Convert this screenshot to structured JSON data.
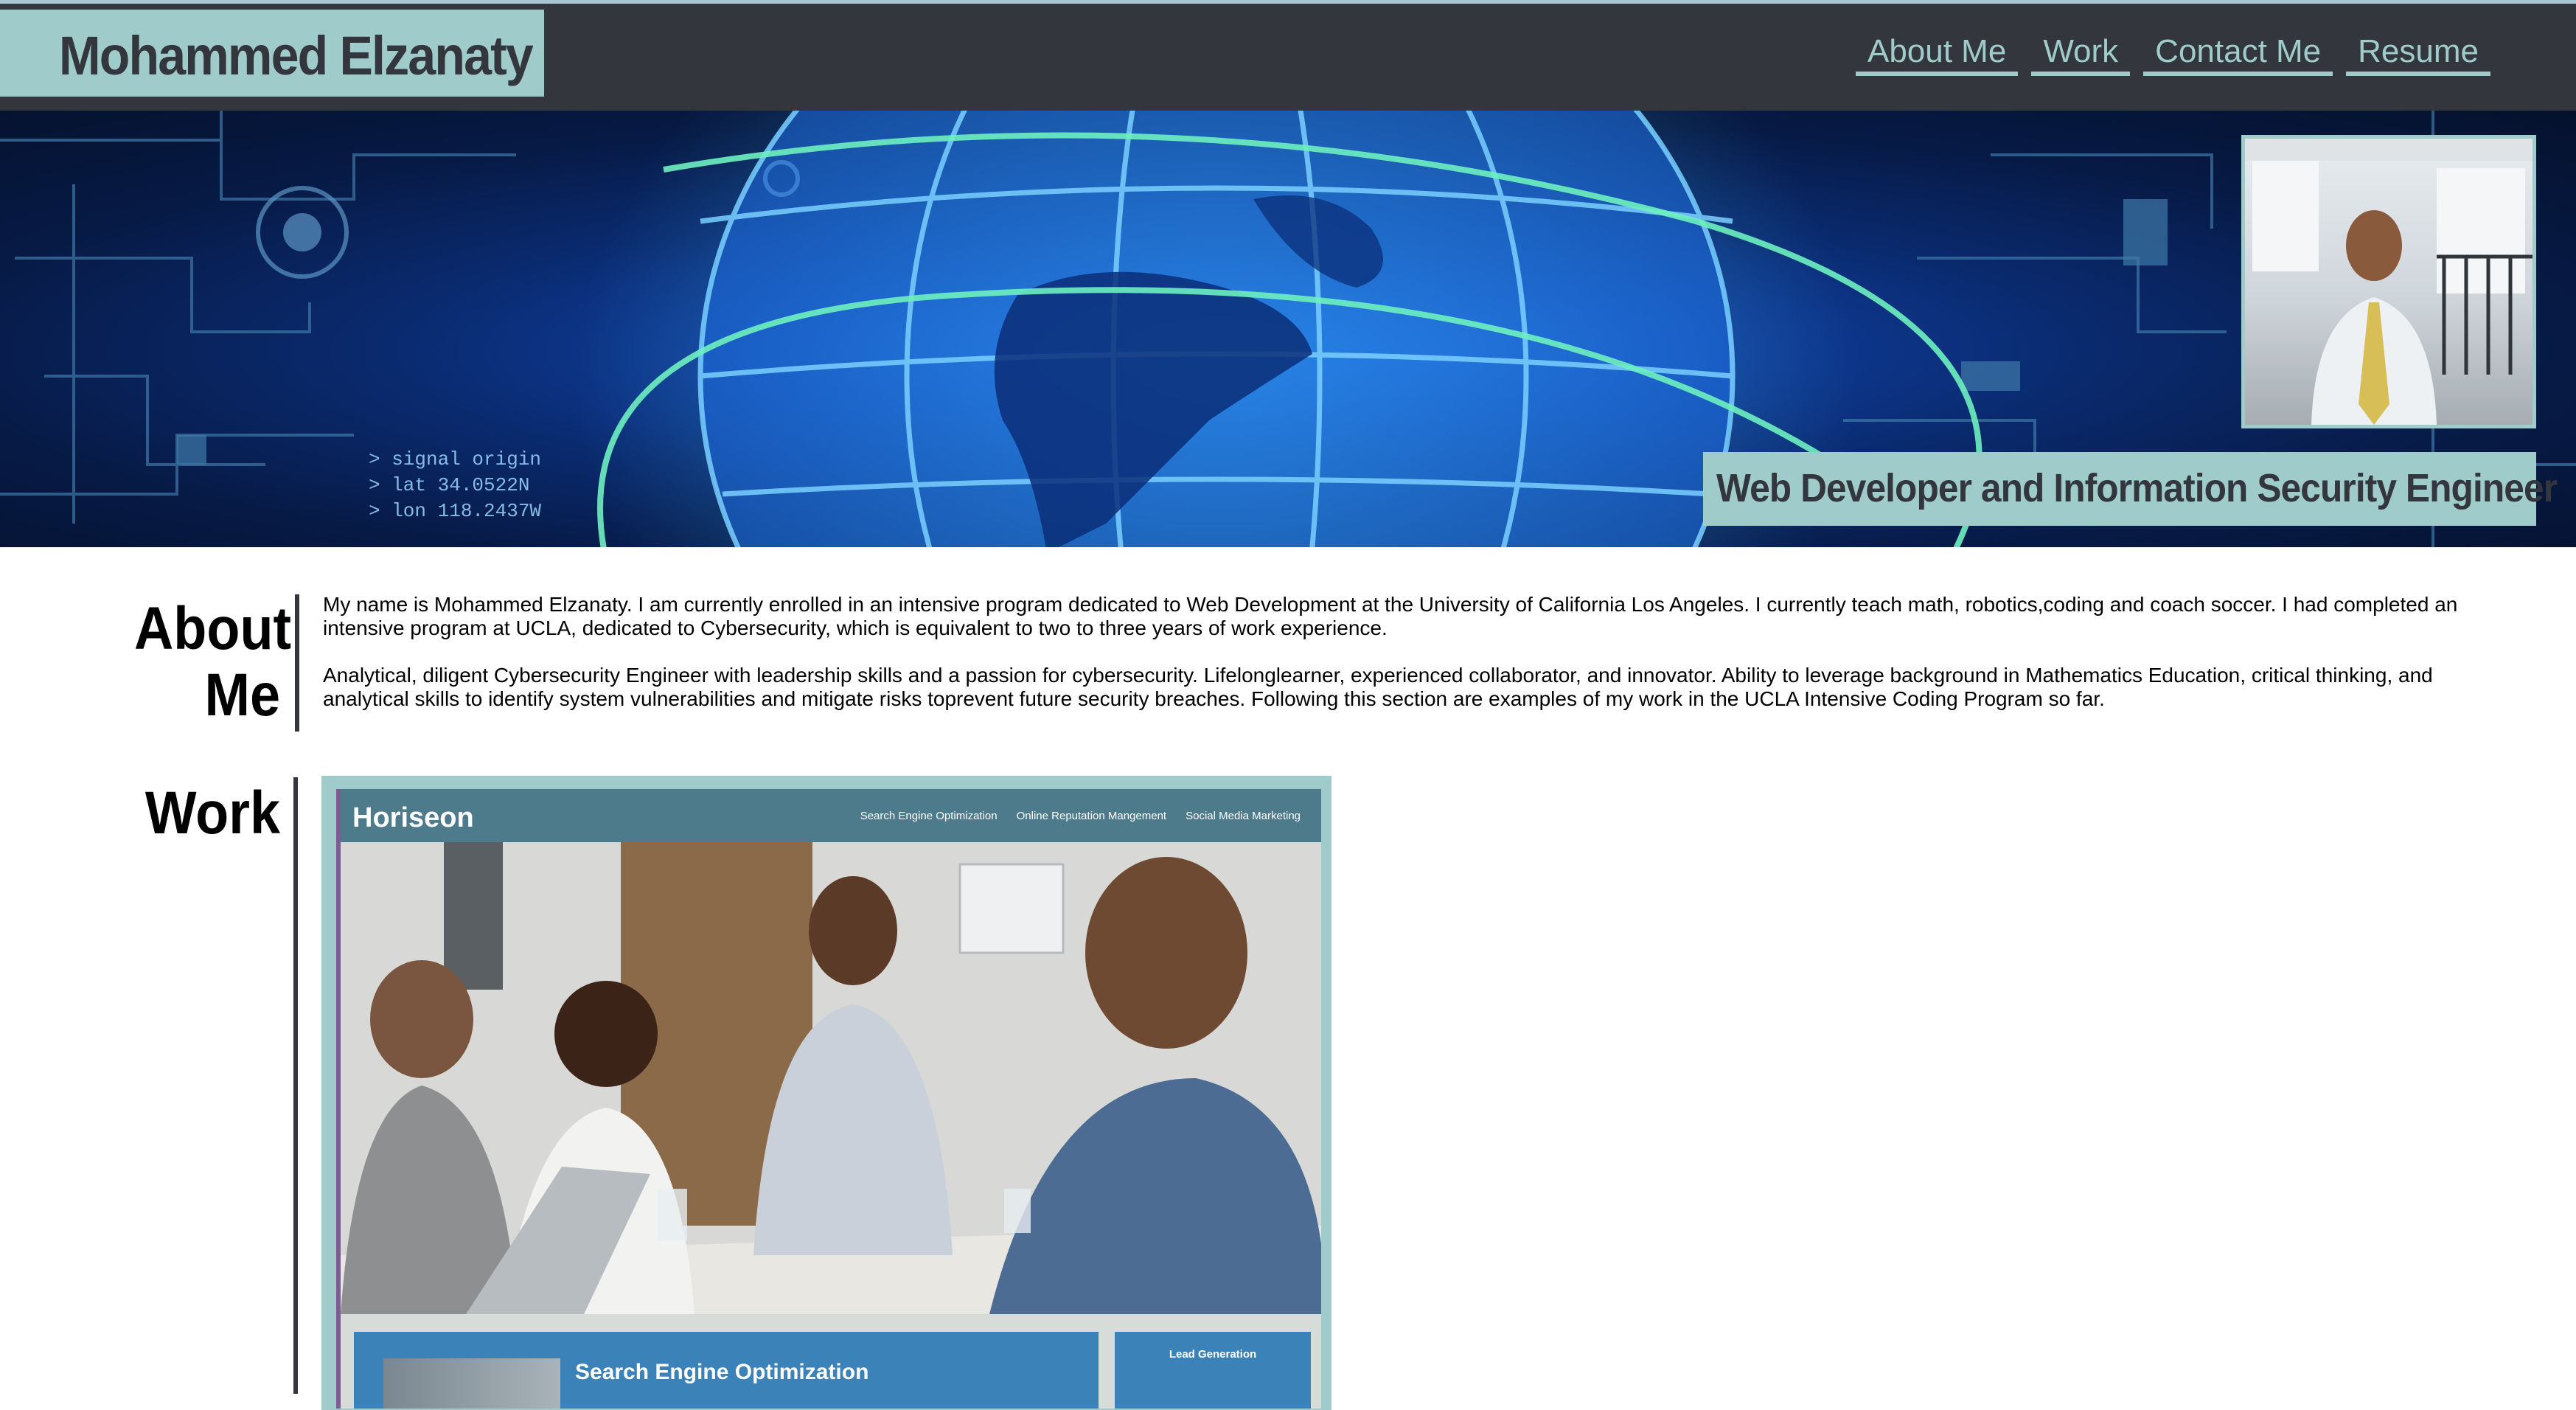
{
  "header": {
    "name": "Mohammed Elzanaty",
    "nav": [
      {
        "label": "About Me"
      },
      {
        "label": "Work"
      },
      {
        "label": "Contact Me"
      },
      {
        "label": "Resume"
      }
    ]
  },
  "hero": {
    "tagline": "Web Developer and Information Security Engineer",
    "hud_lines": [
      "> signal origin",
      "> lat 34.0522N",
      "> lon 118.2437W"
    ]
  },
  "about": {
    "title_line1": "About",
    "title_line2": "Me",
    "paragraphs": [
      "My name is Mohammed Elzanaty. I am currently enrolled in an intensive program dedicated to Web Development at the University of California Los Angeles. I currently teach math, robotics,coding and coach soccer. I had completed an intensive program at UCLA, dedicated to Cybersecurity, which is equivalent to two to three years of work experience.",
      "Analytical, diligent Cybersecurity Engineer with leadership skills and a passion for cybersecurity. Lifelonglearner, experienced collaborator, and innovator. Ability to leverage background in Mathematics Education, critical thinking, and analytical skills to identify system vulnerabilities and mitigate risks toprevent future security breaches. Following this section are examples of my work in the UCLA Intensive Coding Program so far."
    ]
  },
  "work": {
    "title": "Work",
    "project": {
      "brand": "Horiseon",
      "nav": [
        "Search Engine Optimization",
        "Online Reputation Mangement",
        "Social Media Marketing"
      ],
      "section_title": "Search Engine Optimization",
      "sidebar_title": "Lead Generation"
    }
  },
  "colors": {
    "header_bg": "#33363d",
    "accent": "#9fcccb",
    "text_dark": "#33363d"
  }
}
